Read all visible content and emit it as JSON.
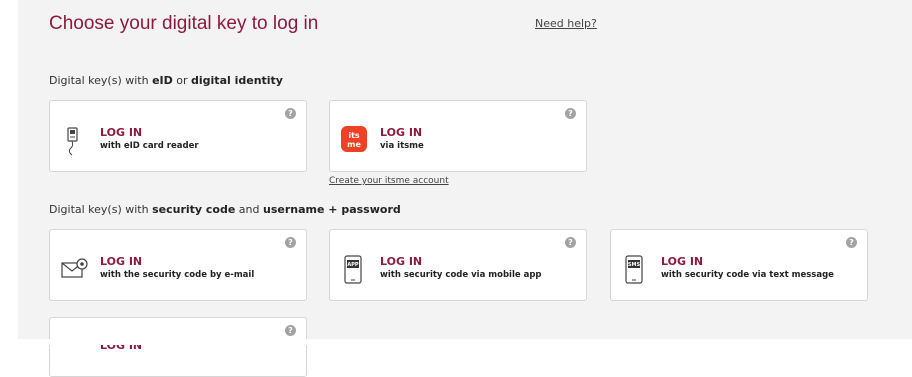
{
  "header": {
    "title": "Choose your digital key to log in",
    "help_link": "Need help?"
  },
  "sections": {
    "eid": {
      "prefix": "Digital key(s) with ",
      "bold1": "eID",
      "mid": " or ",
      "bold2": "digital identity"
    },
    "code": {
      "prefix": "Digital key(s) with ",
      "bold1": "security code",
      "mid": " and ",
      "bold2": "username + password"
    }
  },
  "cards": [
    {
      "title": "LOG IN",
      "sub": "with eID card reader",
      "icon": "card-reader-icon"
    },
    {
      "title": "LOG IN",
      "sub": "via itsme",
      "icon": "itsme-logo-icon",
      "logo_text": "its me",
      "logo_color": "#ef4123"
    },
    {
      "title": "LOG IN",
      "sub": "with the security code by e-mail",
      "icon": "email-icon"
    },
    {
      "title": "LOG IN",
      "sub": "with security code via mobile app",
      "icon": "mobile-app-icon",
      "badge": "APP"
    },
    {
      "title": "LOG IN",
      "sub": "with security code via text message",
      "icon": "sms-icon",
      "badge": "SMS"
    },
    {
      "title": "LOG IN",
      "sub": "",
      "icon": ""
    }
  ],
  "itsme_link": "Create your itsme account",
  "help_glyph": "?",
  "colors": {
    "accent": "#8c1a3e",
    "background": "#f3f3f3",
    "itsme": "#ef4123"
  }
}
